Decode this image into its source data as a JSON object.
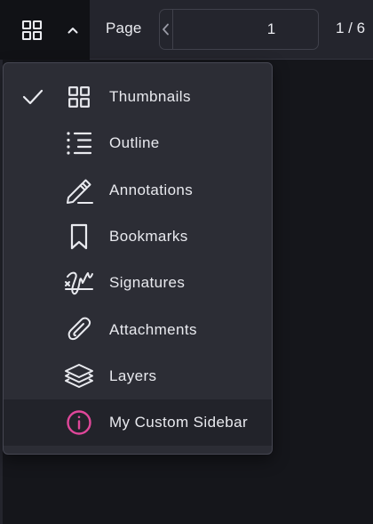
{
  "toolbar": {
    "sidebar_toggle_icon": "grid-icon",
    "sidebar_menu_icon": "chevron-up-icon",
    "page_label": "Page",
    "current_page": "1",
    "page_count": "1 / 6",
    "prev_icon": "chevron-left-icon",
    "next_icon": "chevron-right-icon"
  },
  "sidebar_menu": {
    "items": [
      {
        "label": "Thumbnails",
        "icon": "thumbnails-icon",
        "selected": true
      },
      {
        "label": "Outline",
        "icon": "outline-icon",
        "selected": false
      },
      {
        "label": "Annotations",
        "icon": "annotations-pencil-icon",
        "selected": false
      },
      {
        "label": "Bookmarks",
        "icon": "bookmark-icon",
        "selected": false
      },
      {
        "label": "Signatures",
        "icon": "signature-icon",
        "selected": false
      },
      {
        "label": "Attachments",
        "icon": "paperclip-icon",
        "selected": false
      },
      {
        "label": "Layers",
        "icon": "layers-icon",
        "selected": false
      },
      {
        "label": "My Custom Sidebar",
        "icon": "info-icon",
        "selected": false,
        "highlighted": true
      }
    ]
  },
  "colors": {
    "background": "#15161b",
    "toolbar": "#24252d",
    "menu_background": "#2c2d35",
    "text": "#e9eaef",
    "custom_icon_accent": "#e0479a"
  }
}
